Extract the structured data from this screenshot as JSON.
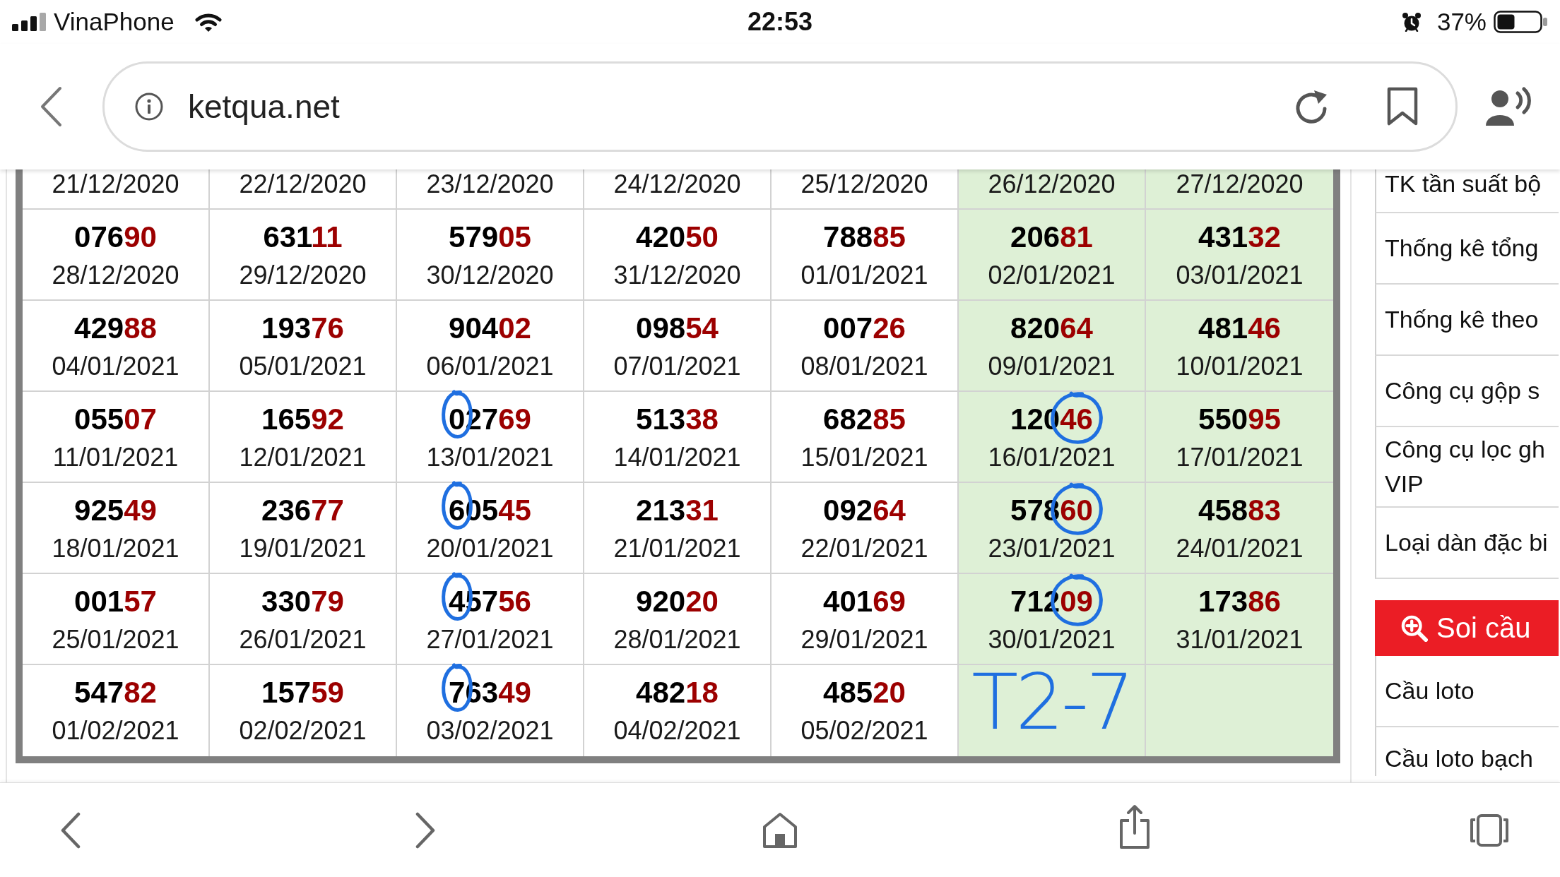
{
  "status_bar": {
    "carrier": "VinaPhone",
    "time": "22:53",
    "battery": "37%"
  },
  "browser": {
    "url": "ketqua.net"
  },
  "results_table": {
    "rows": [
      [
        {
          "date": "21/12/2020",
          "highlighted": false
        },
        {
          "date": "22/12/2020",
          "highlighted": false
        },
        {
          "date": "23/12/2020",
          "highlighted": false
        },
        {
          "date": "24/12/2020",
          "highlighted": false
        },
        {
          "date": "25/12/2020",
          "highlighted": false
        },
        {
          "date": "26/12/2020",
          "highlighted": true
        },
        {
          "date": "27/12/2020",
          "highlighted": true
        }
      ],
      [
        {
          "head": "076",
          "tail": "90",
          "date": "28/12/2020",
          "highlighted": false,
          "first_digit_circled": false,
          "tail_circled": false
        },
        {
          "head": "631",
          "tail": "11",
          "date": "29/12/2020",
          "highlighted": false,
          "first_digit_circled": false,
          "tail_circled": false
        },
        {
          "head": "579",
          "tail": "05",
          "date": "30/12/2020",
          "highlighted": false,
          "first_digit_circled": false,
          "tail_circled": false
        },
        {
          "head": "420",
          "tail": "50",
          "date": "31/12/2020",
          "highlighted": false,
          "first_digit_circled": false,
          "tail_circled": false
        },
        {
          "head": "788",
          "tail": "85",
          "date": "01/01/2021",
          "highlighted": false,
          "first_digit_circled": false,
          "tail_circled": false
        },
        {
          "head": "206",
          "tail": "81",
          "date": "02/01/2021",
          "highlighted": true,
          "first_digit_circled": false,
          "tail_circled": false
        },
        {
          "head": "431",
          "tail": "32",
          "date": "03/01/2021",
          "highlighted": true,
          "first_digit_circled": false,
          "tail_circled": false
        }
      ],
      [
        {
          "head": "429",
          "tail": "88",
          "date": "04/01/2021",
          "highlighted": false,
          "first_digit_circled": false,
          "tail_circled": false
        },
        {
          "head": "193",
          "tail": "76",
          "date": "05/01/2021",
          "highlighted": false,
          "first_digit_circled": false,
          "tail_circled": false
        },
        {
          "head": "904",
          "tail": "02",
          "date": "06/01/2021",
          "highlighted": false,
          "first_digit_circled": false,
          "tail_circled": false
        },
        {
          "head": "098",
          "tail": "54",
          "date": "07/01/2021",
          "highlighted": false,
          "first_digit_circled": false,
          "tail_circled": false
        },
        {
          "head": "007",
          "tail": "26",
          "date": "08/01/2021",
          "highlighted": false,
          "first_digit_circled": false,
          "tail_circled": false
        },
        {
          "head": "820",
          "tail": "64",
          "date": "09/01/2021",
          "highlighted": true,
          "first_digit_circled": false,
          "tail_circled": false
        },
        {
          "head": "481",
          "tail": "46",
          "date": "10/01/2021",
          "highlighted": true,
          "first_digit_circled": false,
          "tail_circled": false
        }
      ],
      [
        {
          "head": "055",
          "tail": "07",
          "date": "11/01/2021",
          "highlighted": false,
          "first_digit_circled": false,
          "tail_circled": false
        },
        {
          "head": "165",
          "tail": "92",
          "date": "12/01/2021",
          "highlighted": false,
          "first_digit_circled": false,
          "tail_circled": false
        },
        {
          "head": "027",
          "tail": "69",
          "date": "13/01/2021",
          "highlighted": false,
          "first_digit_circled": true,
          "tail_circled": false
        },
        {
          "head": "513",
          "tail": "38",
          "date": "14/01/2021",
          "highlighted": false,
          "first_digit_circled": false,
          "tail_circled": false
        },
        {
          "head": "682",
          "tail": "85",
          "date": "15/01/2021",
          "highlighted": false,
          "first_digit_circled": false,
          "tail_circled": false
        },
        {
          "head": "120",
          "tail": "46",
          "date": "16/01/2021",
          "highlighted": true,
          "first_digit_circled": false,
          "tail_circled": true
        },
        {
          "head": "550",
          "tail": "95",
          "date": "17/01/2021",
          "highlighted": true,
          "first_digit_circled": false,
          "tail_circled": false
        }
      ],
      [
        {
          "head": "925",
          "tail": "49",
          "date": "18/01/2021",
          "highlighted": false,
          "first_digit_circled": false,
          "tail_circled": false
        },
        {
          "head": "236",
          "tail": "77",
          "date": "19/01/2021",
          "highlighted": false,
          "first_digit_circled": false,
          "tail_circled": false
        },
        {
          "head": "605",
          "tail": "45",
          "date": "20/01/2021",
          "highlighted": false,
          "first_digit_circled": true,
          "tail_circled": false
        },
        {
          "head": "213",
          "tail": "31",
          "date": "21/01/2021",
          "highlighted": false,
          "first_digit_circled": false,
          "tail_circled": false
        },
        {
          "head": "092",
          "tail": "64",
          "date": "22/01/2021",
          "highlighted": false,
          "first_digit_circled": false,
          "tail_circled": false
        },
        {
          "head": "578",
          "tail": "60",
          "date": "23/01/2021",
          "highlighted": true,
          "first_digit_circled": false,
          "tail_circled": true
        },
        {
          "head": "458",
          "tail": "83",
          "date": "24/01/2021",
          "highlighted": true,
          "first_digit_circled": false,
          "tail_circled": false
        }
      ],
      [
        {
          "head": "001",
          "tail": "57",
          "date": "25/01/2021",
          "highlighted": false,
          "first_digit_circled": false,
          "tail_circled": false
        },
        {
          "head": "330",
          "tail": "79",
          "date": "26/01/2021",
          "highlighted": false,
          "first_digit_circled": false,
          "tail_circled": false
        },
        {
          "head": "457",
          "tail": "56",
          "date": "27/01/2021",
          "highlighted": false,
          "first_digit_circled": true,
          "tail_circled": false
        },
        {
          "head": "920",
          "tail": "20",
          "date": "28/01/2021",
          "highlighted": false,
          "first_digit_circled": false,
          "tail_circled": false
        },
        {
          "head": "401",
          "tail": "69",
          "date": "29/01/2021",
          "highlighted": false,
          "first_digit_circled": false,
          "tail_circled": false
        },
        {
          "head": "712",
          "tail": "09",
          "date": "30/01/2021",
          "highlighted": true,
          "first_digit_circled": false,
          "tail_circled": true
        },
        {
          "head": "173",
          "tail": "86",
          "date": "31/01/2021",
          "highlighted": true,
          "first_digit_circled": false,
          "tail_circled": false
        }
      ],
      [
        {
          "head": "547",
          "tail": "82",
          "date": "01/02/2021",
          "highlighted": false,
          "first_digit_circled": false,
          "tail_circled": false
        },
        {
          "head": "157",
          "tail": "59",
          "date": "02/02/2021",
          "highlighted": false,
          "first_digit_circled": false,
          "tail_circled": false
        },
        {
          "head": "763",
          "tail": "49",
          "date": "03/02/2021",
          "highlighted": false,
          "first_digit_circled": true,
          "tail_circled": false
        },
        {
          "head": "482",
          "tail": "18",
          "date": "04/02/2021",
          "highlighted": false,
          "first_digit_circled": false,
          "tail_circled": false
        },
        {
          "head": "485",
          "tail": "20",
          "date": "05/02/2021",
          "highlighted": false,
          "first_digit_circled": false,
          "tail_circled": false
        },
        {
          "highlighted": true,
          "handwriting": "T2-7"
        },
        {
          "highlighted": true
        }
      ]
    ]
  },
  "sidebar": {
    "items": [
      {
        "kind": "link",
        "lines": [
          "TK tần suất bộ"
        ]
      },
      {
        "kind": "link",
        "lines": [
          "Thống kê tổng"
        ]
      },
      {
        "kind": "link",
        "lines": [
          "Thống kê theo"
        ]
      },
      {
        "kind": "link",
        "lines": [
          "Công cụ gộp s"
        ]
      },
      {
        "kind": "link",
        "lines": [
          "Công cụ lọc gh",
          "VIP"
        ]
      },
      {
        "kind": "link",
        "lines": [
          "Loại dàn đặc bi"
        ]
      },
      {
        "kind": "heading",
        "lines": [
          "Soi cầu"
        ]
      },
      {
        "kind": "link",
        "lines": [
          "Cầu loto"
        ]
      },
      {
        "kind": "link",
        "lines": [
          "Cầu loto bạch"
        ]
      }
    ]
  }
}
